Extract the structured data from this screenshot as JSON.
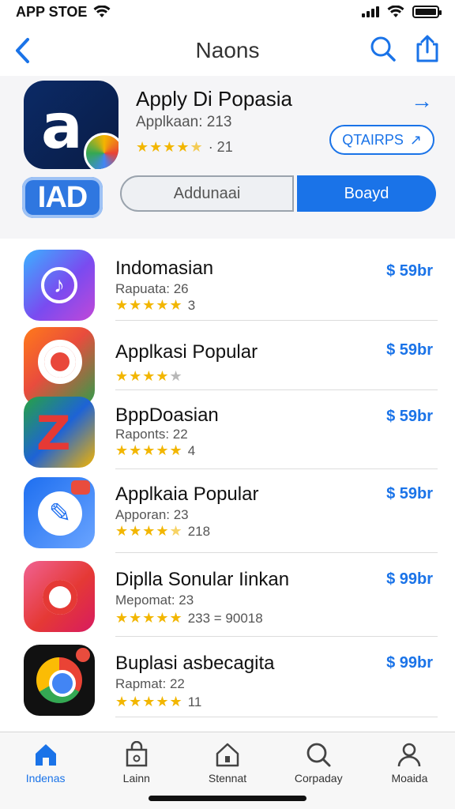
{
  "status_bar": {
    "carrier": "APP STOE"
  },
  "nav": {
    "title": "Naons"
  },
  "featured": {
    "name": "Apply Di Popasia",
    "subtitle": "Applkaan: 213",
    "rating_count": "· 21",
    "stars": 4.5,
    "pill_label": "QTAIRPS",
    "badge_text": "IAD",
    "segment_left": "Addunaai",
    "segment_right": "Boayd"
  },
  "apps": [
    {
      "name": "Indomasian",
      "meta": "Rapuata: 26",
      "rating": "3",
      "stars": 5,
      "price": "$ 59br",
      "icon": "music-icon"
    },
    {
      "name": "Applkasi Popular",
      "meta": "",
      "rating": "★",
      "stars": 4,
      "price": "$ 59br",
      "icon": "target-icon"
    },
    {
      "name": "BppDoasian",
      "meta": "Raponts: 22",
      "rating": "4",
      "stars": 5,
      "price": "$ 59br",
      "icon": "z-logo-icon"
    },
    {
      "name": "Applkaia Popular",
      "meta": "Apporan: 23",
      "rating": "218",
      "stars": 4.5,
      "price": "$ 59br",
      "icon": "pen-icon"
    },
    {
      "name": "Diplla Sonular Iinkan",
      "meta": "Mepomat: 23",
      "rating": "233 = 90018",
      "stars": 5,
      "price": "$ 99br",
      "icon": "camera-icon"
    },
    {
      "name": "Buplasi asbecagita",
      "meta": "Rapmat: 22",
      "rating": "11",
      "stars": 5,
      "price": "$ 99br",
      "icon": "chrome-icon"
    }
  ],
  "tabs": [
    {
      "label": "Indenas",
      "icon": "home-icon",
      "active": true
    },
    {
      "label": "Lainn",
      "icon": "bag-icon",
      "active": false
    },
    {
      "label": "Stennat",
      "icon": "house-outline-icon",
      "active": false
    },
    {
      "label": "Corpaday",
      "icon": "search-icon",
      "active": false
    },
    {
      "label": "Moaida",
      "icon": "person-icon",
      "active": false
    }
  ],
  "colors": {
    "accent": "#1a73e8",
    "star": "#f2b600"
  }
}
